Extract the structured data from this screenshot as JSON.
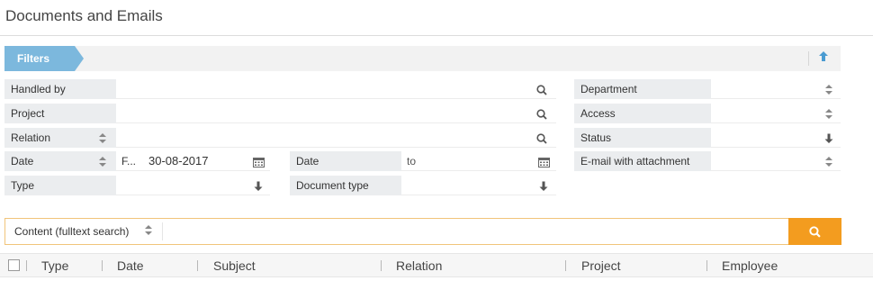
{
  "page": {
    "title": "Documents and Emails"
  },
  "filters": {
    "tab_label": "Filters",
    "collapse_icon": "arrow-up-icon",
    "handled_by": {
      "label": "Handled by",
      "value": ""
    },
    "project": {
      "label": "Project",
      "value": ""
    },
    "relation": {
      "label": "Relation",
      "value": ""
    },
    "date_left": {
      "label": "Date",
      "mode": "F...",
      "value": "30-08-2017"
    },
    "type": {
      "label": "Type",
      "value": ""
    },
    "date_right": {
      "label": "Date",
      "placeholder": "to",
      "value": ""
    },
    "document_type": {
      "label": "Document type",
      "value": ""
    },
    "department": {
      "label": "Department",
      "value": ""
    },
    "access": {
      "label": "Access",
      "value": ""
    },
    "status": {
      "label": "Status",
      "value": ""
    },
    "email_attachment": {
      "label": "E-mail with attachment",
      "value": ""
    }
  },
  "search": {
    "mode": "Content (fulltext search)",
    "value": "",
    "button_icon": "search-icon",
    "accent": "#f39c1f"
  },
  "table": {
    "columns": [
      "Type",
      "Date",
      "Subject",
      "Relation",
      "Project",
      "Employee"
    ],
    "rows": []
  },
  "colors": {
    "tab": "#7cb8dd",
    "label_bg": "#ebedef",
    "search_border": "#f1c47a"
  }
}
